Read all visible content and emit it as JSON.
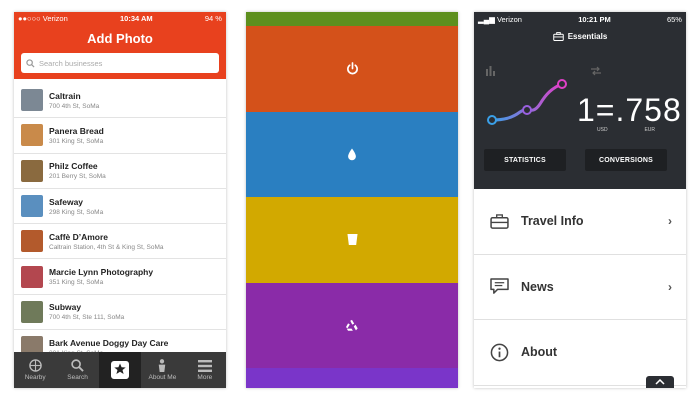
{
  "phone1": {
    "status": {
      "carrier": "●●○○○ Verizon",
      "time": "10:34 AM",
      "battery": "94 %"
    },
    "title": "Add Photo",
    "search": {
      "placeholder": "Search businesses"
    },
    "items": [
      {
        "name": "Caltrain",
        "address": "700 4th St, SoMa",
        "thumb": "#7c8894",
        "icon": "caltrain-thumb"
      },
      {
        "name": "Panera Bread",
        "address": "301 King St, SoMa",
        "thumb": "#c98a4a",
        "icon": "panera-thumb"
      },
      {
        "name": "Philz Coffee",
        "address": "201 Berry St, SoMa",
        "thumb": "#8a6a3f",
        "icon": "philz-thumb"
      },
      {
        "name": "Safeway",
        "address": "298 King St, SoMa",
        "thumb": "#5a8fbf",
        "icon": "safeway-thumb"
      },
      {
        "name": "Caffè D’Amore",
        "address": "Caltrain Station, 4th St & King St, SoMa",
        "thumb": "#b35a2c",
        "icon": "caffe-thumb"
      },
      {
        "name": "Marcie Lynn Photography",
        "address": "351 King St, SoMa",
        "thumb": "#b3474f",
        "icon": "photo-thumb"
      },
      {
        "name": "Subway",
        "address": "700 4th St, Ste 111, SoMa",
        "thumb": "#6f7a5a",
        "icon": "subway-thumb"
      },
      {
        "name": "Bark Avenue Doggy Day Care",
        "address": "301 King St, SoMa",
        "thumb": "#8a7a6a",
        "icon": "bark-thumb"
      }
    ],
    "tabs": [
      {
        "label": "Nearby",
        "icon": "nearby-icon"
      },
      {
        "label": "Search",
        "icon": "search-icon"
      },
      {
        "label": "",
        "icon": "camera-star-icon"
      },
      {
        "label": "About Me",
        "icon": "person-icon"
      },
      {
        "label": "More",
        "icon": "menu-icon"
      }
    ],
    "accent": "#e8411e"
  },
  "phone2": {
    "bars": [
      {
        "color": "#d4511a",
        "icon": "power-icon"
      },
      {
        "color": "#2a7fc1",
        "icon": "drop-icon"
      },
      {
        "color": "#d2a900",
        "icon": "cup-icon"
      },
      {
        "color": "#8a2ba8",
        "icon": "recycle-icon"
      }
    ]
  },
  "phone3": {
    "status": {
      "carrier": "Verizon",
      "time": "10:21 PM",
      "battery": "65%"
    },
    "title": "Essentials",
    "cards": {
      "statistics_label": "STATISTICS",
      "conversions_label": "CONVERSIONS",
      "rate": "1=.758",
      "from_currency": "USD",
      "to_currency": "EUR"
    },
    "menu": [
      {
        "label": "Travel Info",
        "icon": "suitcase-icon"
      },
      {
        "label": "News",
        "icon": "chat-icon"
      },
      {
        "label": "About",
        "icon": "info-icon"
      }
    ]
  }
}
